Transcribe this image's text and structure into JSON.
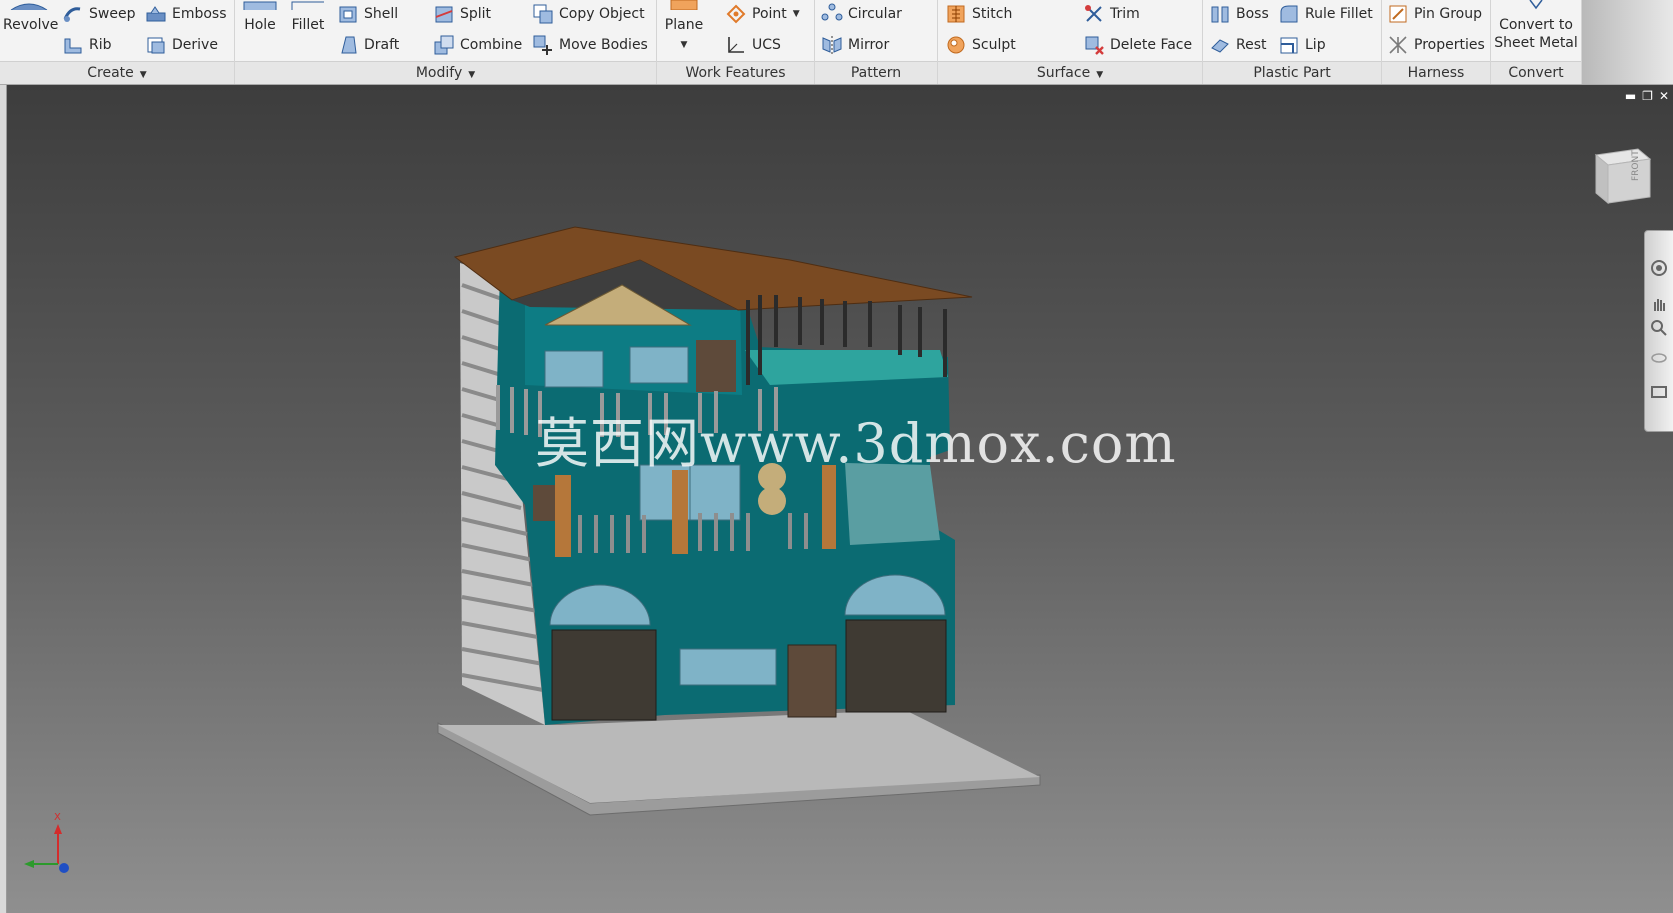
{
  "ribbon": {
    "panels": [
      {
        "label": "Create",
        "has_menu": true
      },
      {
        "label": "Modify",
        "has_menu": true
      },
      {
        "label": "Work Features",
        "has_menu": false
      },
      {
        "label": "Pattern",
        "has_menu": false
      },
      {
        "label": "Surface",
        "has_menu": true
      },
      {
        "label": "Plastic Part",
        "has_menu": false
      },
      {
        "label": "Harness",
        "has_menu": false
      },
      {
        "label": "Convert",
        "has_menu": false
      }
    ],
    "tools": {
      "revolve": "Revolve",
      "sweep": "Sweep",
      "emboss": "Emboss",
      "rib": "Rib",
      "derive": "Derive",
      "hole": "Hole",
      "fillet": "Fillet",
      "shell": "Shell",
      "split": "Split",
      "copy_object": "Copy Object",
      "draft": "Draft",
      "combine": "Combine",
      "move_bodies": "Move Bodies",
      "plane": "Plane",
      "point": "Point",
      "ucs": "UCS",
      "circular": "Circular",
      "mirror": "Mirror",
      "stitch": "Stitch",
      "sculpt": "Sculpt",
      "trim": "Trim",
      "delete_face": "Delete Face",
      "boss": "Boss",
      "rule_fillet": "Rule Fillet",
      "rest": "Rest",
      "lip": "Lip",
      "pin_group": "Pin Group",
      "properties": "Properties",
      "convert_line1": "Convert to",
      "convert_line2": "Sheet Metal"
    }
  },
  "viewport": {
    "viewcube_face": "FRONT",
    "watermark": "莫西网www.3dmox.com",
    "axis_label_x": "X"
  },
  "colors": {
    "ribbon_bg": "#f3f3f3",
    "panel_footer_bg": "#e6e6e6",
    "model_wall": "#0b6b72",
    "model_roof": "#7a4a22",
    "model_stone": "#5e4a3a"
  }
}
